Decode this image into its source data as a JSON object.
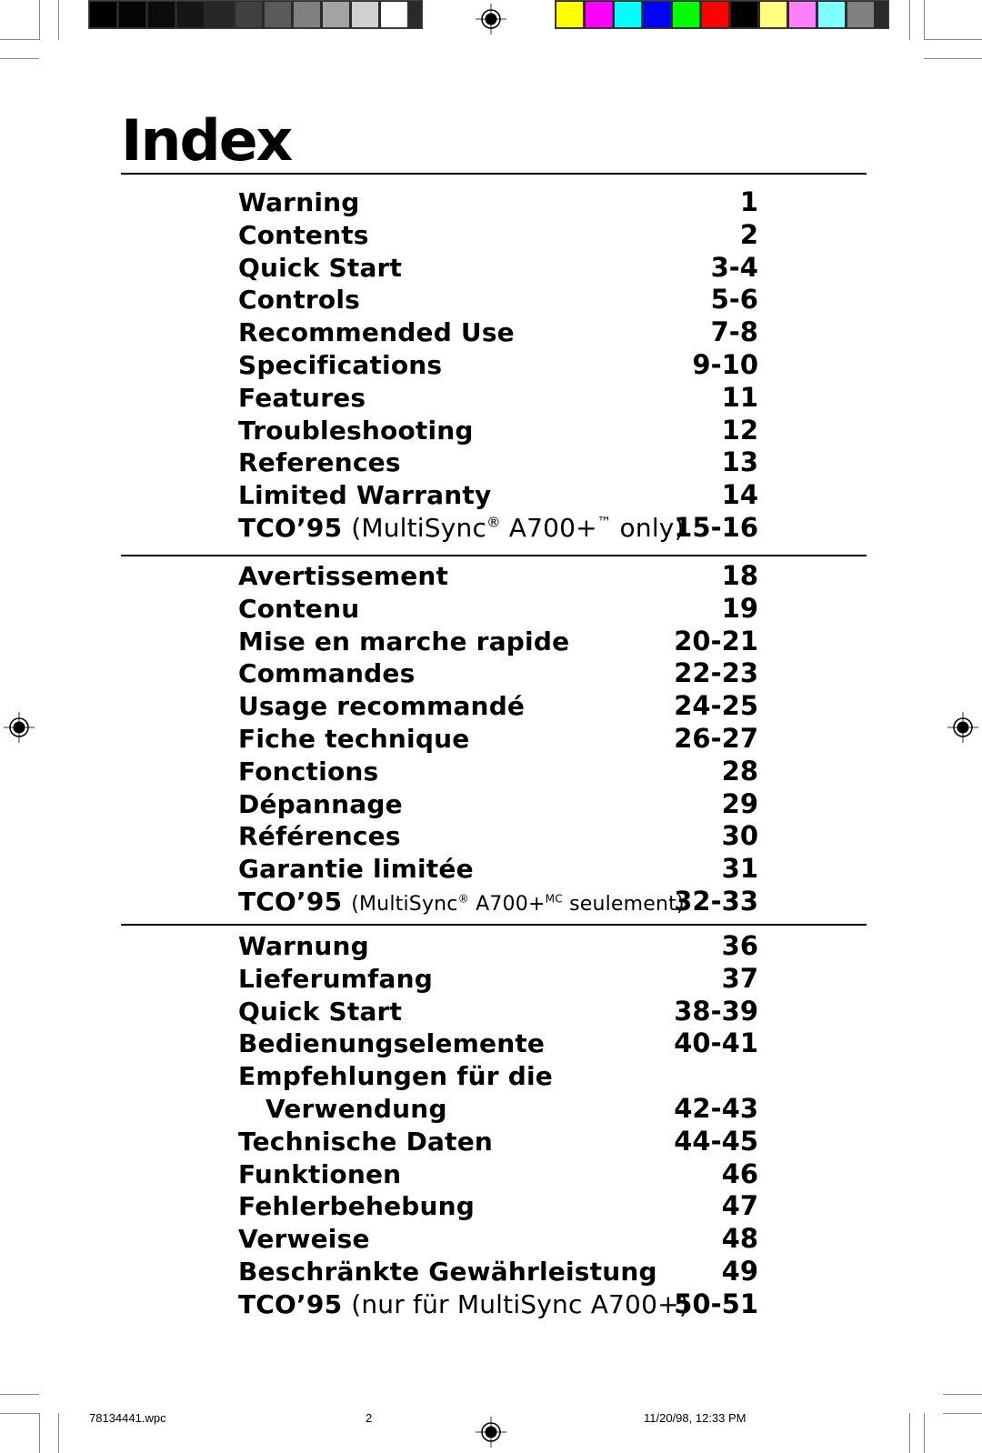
{
  "calibration": {
    "grayscale": [
      "#000000",
      "#050505",
      "#0b0b0b",
      "#161616",
      "#262626",
      "#404040",
      "#5a5a5a",
      "#7f7f7f",
      "#a3a3a3",
      "#d0d0d0",
      "#ffffff"
    ],
    "colors": [
      "#ffff00",
      "#ff00ff",
      "#00ffff",
      "#0000ff",
      "#00ff00",
      "#ff0000",
      "#000000",
      "#ffff80",
      "#ff80ff",
      "#80ffff",
      "#808080"
    ]
  },
  "title": "Index",
  "sections": [
    {
      "entries": [
        {
          "label": "Warning",
          "page": "1"
        },
        {
          "label": "Contents",
          "page": "2"
        },
        {
          "label": "Quick Start",
          "page": "3-4"
        },
        {
          "label": "Controls",
          "page": "5-6"
        },
        {
          "label": "Recommended Use",
          "page": "7-8"
        },
        {
          "label": "Specifications",
          "page": "9-10"
        },
        {
          "label": "Features",
          "page": "11"
        },
        {
          "label": "Troubleshooting",
          "page": "12"
        },
        {
          "label": "References",
          "page": "13"
        },
        {
          "label": "Limited Warranty",
          "page": "14"
        }
      ],
      "tco": {
        "label": "TCO’95",
        "pre": "(MultiSync",
        "reg": "®",
        "mid": "A700+",
        "mark": "™",
        "post": "only)",
        "page": "15-16"
      }
    },
    {
      "entries": [
        {
          "label": "Avertissement",
          "page": "18"
        },
        {
          "label": "Contenu",
          "page": "19"
        },
        {
          "label": "Mise en marche rapide",
          "page": "20-21"
        },
        {
          "label": "Commandes",
          "page": "22-23"
        },
        {
          "label": "Usage recommandé",
          "page": "24-25"
        },
        {
          "label": "Fiche technique",
          "page": "26-27"
        },
        {
          "label": "Fonctions",
          "page": "28"
        },
        {
          "label": "Dépannage",
          "page": "29"
        },
        {
          "label": "Références",
          "page": "30"
        },
        {
          "label": "Garantie limitée",
          "page": "31"
        }
      ],
      "tco": {
        "label": "TCO’95",
        "pre": "(MultiSync",
        "reg": "®",
        "mid": "A700+",
        "mark": "MC",
        "post": "seulement)",
        "page": "32-33"
      }
    },
    {
      "entries": [
        {
          "label": "Warnung",
          "page": "36"
        },
        {
          "label": "Lieferumfang",
          "page": "37"
        },
        {
          "label": "Quick Start",
          "page": "38-39"
        },
        {
          "label": "Bedienungselemente",
          "page": "40-41"
        },
        {
          "label": "Empfehlungen für die",
          "page": ""
        },
        {
          "label": "Verwendung",
          "page": "42-43",
          "indent": true
        },
        {
          "label": "Technische Daten",
          "page": "44-45"
        },
        {
          "label": "Funktionen",
          "page": "46"
        },
        {
          "label": "Fehlerbehebung",
          "page": "47"
        },
        {
          "label": "Verweise",
          "page": "48"
        },
        {
          "label": "Beschränkte Gewährleistung",
          "page": "49"
        }
      ],
      "tco": {
        "label": "TCO’95",
        "text": "(nur für MultiSync A700+)",
        "page": "50-51"
      }
    }
  ],
  "footer": {
    "filename": "78134441.wpc",
    "page": "2",
    "datetime": "11/20/98, 12:33 PM"
  }
}
